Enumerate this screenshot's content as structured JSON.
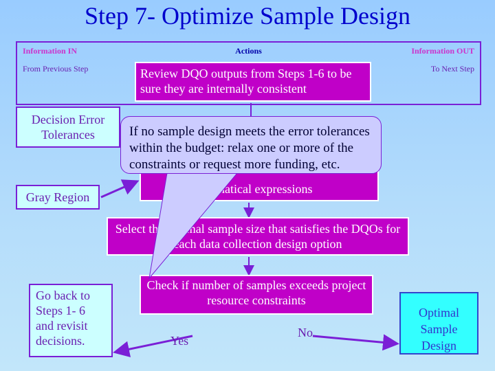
{
  "title": "Step 7- Optimize Sample Design",
  "header": {
    "info_in": "Information IN",
    "actions": "Actions",
    "info_out": "Information OUT",
    "from_prev": "From Previous Step",
    "to_next": "To Next Step"
  },
  "actions": {
    "review": "Review DQO outputs from Steps 1-6 to be sure they are internally consistent",
    "math": "...matical expressions",
    "select": "Select the optimal sample size that satisfies the DQOs for each data collection design option",
    "check": "Check if number of samples exceeds project resource constraints"
  },
  "inputs": {
    "decision_error": "Decision Error Tolerances",
    "gray_region": "Gray Region"
  },
  "outputs": {
    "go_back": "Go back to Steps 1- 6 and revisit decisions.",
    "optimal": "Optimal Sample Design"
  },
  "branches": {
    "yes": "Yes",
    "no": "No"
  },
  "callout": "If no sample design meets the error tolerances within the budget: relax one or more of the constraints or request more funding, etc.",
  "colors": {
    "action_fill": "#c000c8",
    "input_fill": "#ccffff",
    "output_fill": "#33ffff",
    "line": "#7a1fd6",
    "callout_fill": "#ccccff"
  }
}
